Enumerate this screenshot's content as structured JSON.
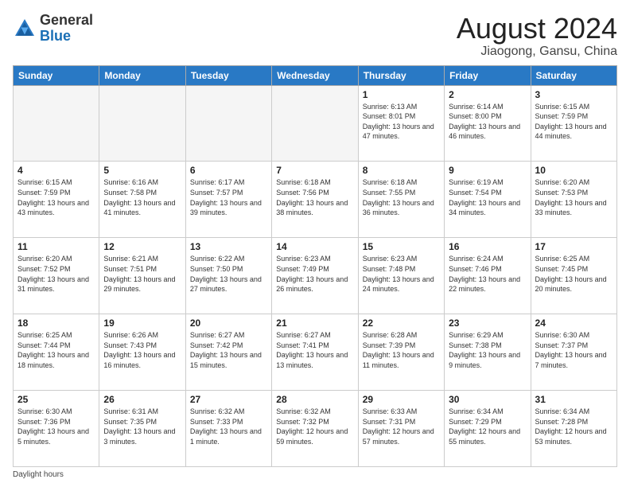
{
  "logo": {
    "general": "General",
    "blue": "Blue"
  },
  "header": {
    "title": "August 2024",
    "subtitle": "Jiaogong, Gansu, China"
  },
  "days_of_week": [
    "Sunday",
    "Monday",
    "Tuesday",
    "Wednesday",
    "Thursday",
    "Friday",
    "Saturday"
  ],
  "weeks": [
    [
      {
        "day": "",
        "info": ""
      },
      {
        "day": "",
        "info": ""
      },
      {
        "day": "",
        "info": ""
      },
      {
        "day": "",
        "info": ""
      },
      {
        "day": "1",
        "info": "Sunrise: 6:13 AM\nSunset: 8:01 PM\nDaylight: 13 hours\nand 47 minutes."
      },
      {
        "day": "2",
        "info": "Sunrise: 6:14 AM\nSunset: 8:00 PM\nDaylight: 13 hours\nand 46 minutes."
      },
      {
        "day": "3",
        "info": "Sunrise: 6:15 AM\nSunset: 7:59 PM\nDaylight: 13 hours\nand 44 minutes."
      }
    ],
    [
      {
        "day": "4",
        "info": "Sunrise: 6:15 AM\nSunset: 7:59 PM\nDaylight: 13 hours\nand 43 minutes."
      },
      {
        "day": "5",
        "info": "Sunrise: 6:16 AM\nSunset: 7:58 PM\nDaylight: 13 hours\nand 41 minutes."
      },
      {
        "day": "6",
        "info": "Sunrise: 6:17 AM\nSunset: 7:57 PM\nDaylight: 13 hours\nand 39 minutes."
      },
      {
        "day": "7",
        "info": "Sunrise: 6:18 AM\nSunset: 7:56 PM\nDaylight: 13 hours\nand 38 minutes."
      },
      {
        "day": "8",
        "info": "Sunrise: 6:18 AM\nSunset: 7:55 PM\nDaylight: 13 hours\nand 36 minutes."
      },
      {
        "day": "9",
        "info": "Sunrise: 6:19 AM\nSunset: 7:54 PM\nDaylight: 13 hours\nand 34 minutes."
      },
      {
        "day": "10",
        "info": "Sunrise: 6:20 AM\nSunset: 7:53 PM\nDaylight: 13 hours\nand 33 minutes."
      }
    ],
    [
      {
        "day": "11",
        "info": "Sunrise: 6:20 AM\nSunset: 7:52 PM\nDaylight: 13 hours\nand 31 minutes."
      },
      {
        "day": "12",
        "info": "Sunrise: 6:21 AM\nSunset: 7:51 PM\nDaylight: 13 hours\nand 29 minutes."
      },
      {
        "day": "13",
        "info": "Sunrise: 6:22 AM\nSunset: 7:50 PM\nDaylight: 13 hours\nand 27 minutes."
      },
      {
        "day": "14",
        "info": "Sunrise: 6:23 AM\nSunset: 7:49 PM\nDaylight: 13 hours\nand 26 minutes."
      },
      {
        "day": "15",
        "info": "Sunrise: 6:23 AM\nSunset: 7:48 PM\nDaylight: 13 hours\nand 24 minutes."
      },
      {
        "day": "16",
        "info": "Sunrise: 6:24 AM\nSunset: 7:46 PM\nDaylight: 13 hours\nand 22 minutes."
      },
      {
        "day": "17",
        "info": "Sunrise: 6:25 AM\nSunset: 7:45 PM\nDaylight: 13 hours\nand 20 minutes."
      }
    ],
    [
      {
        "day": "18",
        "info": "Sunrise: 6:25 AM\nSunset: 7:44 PM\nDaylight: 13 hours\nand 18 minutes."
      },
      {
        "day": "19",
        "info": "Sunrise: 6:26 AM\nSunset: 7:43 PM\nDaylight: 13 hours\nand 16 minutes."
      },
      {
        "day": "20",
        "info": "Sunrise: 6:27 AM\nSunset: 7:42 PM\nDaylight: 13 hours\nand 15 minutes."
      },
      {
        "day": "21",
        "info": "Sunrise: 6:27 AM\nSunset: 7:41 PM\nDaylight: 13 hours\nand 13 minutes."
      },
      {
        "day": "22",
        "info": "Sunrise: 6:28 AM\nSunset: 7:39 PM\nDaylight: 13 hours\nand 11 minutes."
      },
      {
        "day": "23",
        "info": "Sunrise: 6:29 AM\nSunset: 7:38 PM\nDaylight: 13 hours\nand 9 minutes."
      },
      {
        "day": "24",
        "info": "Sunrise: 6:30 AM\nSunset: 7:37 PM\nDaylight: 13 hours\nand 7 minutes."
      }
    ],
    [
      {
        "day": "25",
        "info": "Sunrise: 6:30 AM\nSunset: 7:36 PM\nDaylight: 13 hours\nand 5 minutes."
      },
      {
        "day": "26",
        "info": "Sunrise: 6:31 AM\nSunset: 7:35 PM\nDaylight: 13 hours\nand 3 minutes."
      },
      {
        "day": "27",
        "info": "Sunrise: 6:32 AM\nSunset: 7:33 PM\nDaylight: 13 hours\nand 1 minute."
      },
      {
        "day": "28",
        "info": "Sunrise: 6:32 AM\nSunset: 7:32 PM\nDaylight: 12 hours\nand 59 minutes."
      },
      {
        "day": "29",
        "info": "Sunrise: 6:33 AM\nSunset: 7:31 PM\nDaylight: 12 hours\nand 57 minutes."
      },
      {
        "day": "30",
        "info": "Sunrise: 6:34 AM\nSunset: 7:29 PM\nDaylight: 12 hours\nand 55 minutes."
      },
      {
        "day": "31",
        "info": "Sunrise: 6:34 AM\nSunset: 7:28 PM\nDaylight: 12 hours\nand 53 minutes."
      }
    ]
  ],
  "footer": {
    "daylight_label": "Daylight hours"
  }
}
